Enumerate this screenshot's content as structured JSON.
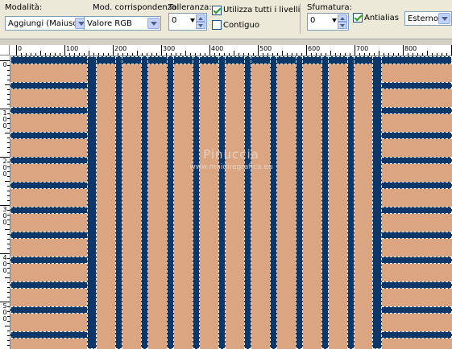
{
  "toolbar": {
    "mode": {
      "label": "Modalità:",
      "value": "Aggiungi (Maiusc)"
    },
    "match_mode": {
      "label": "Mod. corrispondenza:",
      "value": "Valore RGB"
    },
    "tolerance": {
      "label": "Tolleranza:",
      "value": "0"
    },
    "use_all_layers": {
      "label": "Utilizza tutti i livelli",
      "checked": true
    },
    "contiguous": {
      "label": "Contiguo",
      "checked": false
    },
    "feather": {
      "label": "Sfumatura:",
      "value": "0"
    },
    "antialias": {
      "label": "Antialias",
      "checked": true
    },
    "antialias_mode": {
      "value": "Esterno"
    }
  },
  "ruler_top": {
    "labels": [
      "0",
      "100",
      "200",
      "300",
      "400",
      "500",
      "600",
      "700",
      "800"
    ]
  },
  "ruler_left": {
    "labels": [
      "0",
      "1\n0\n0",
      "2\n0\n0",
      "3\n0\n0",
      "4\n0\n0",
      "5\n0\n0"
    ]
  },
  "canvas": {
    "watermark_title": "Pinuccia",
    "watermark_url": "www.maidiregrafica.eu",
    "colors": {
      "background": "#dba582",
      "stripe": "#0d3768",
      "marquee": "#ffffff"
    }
  }
}
